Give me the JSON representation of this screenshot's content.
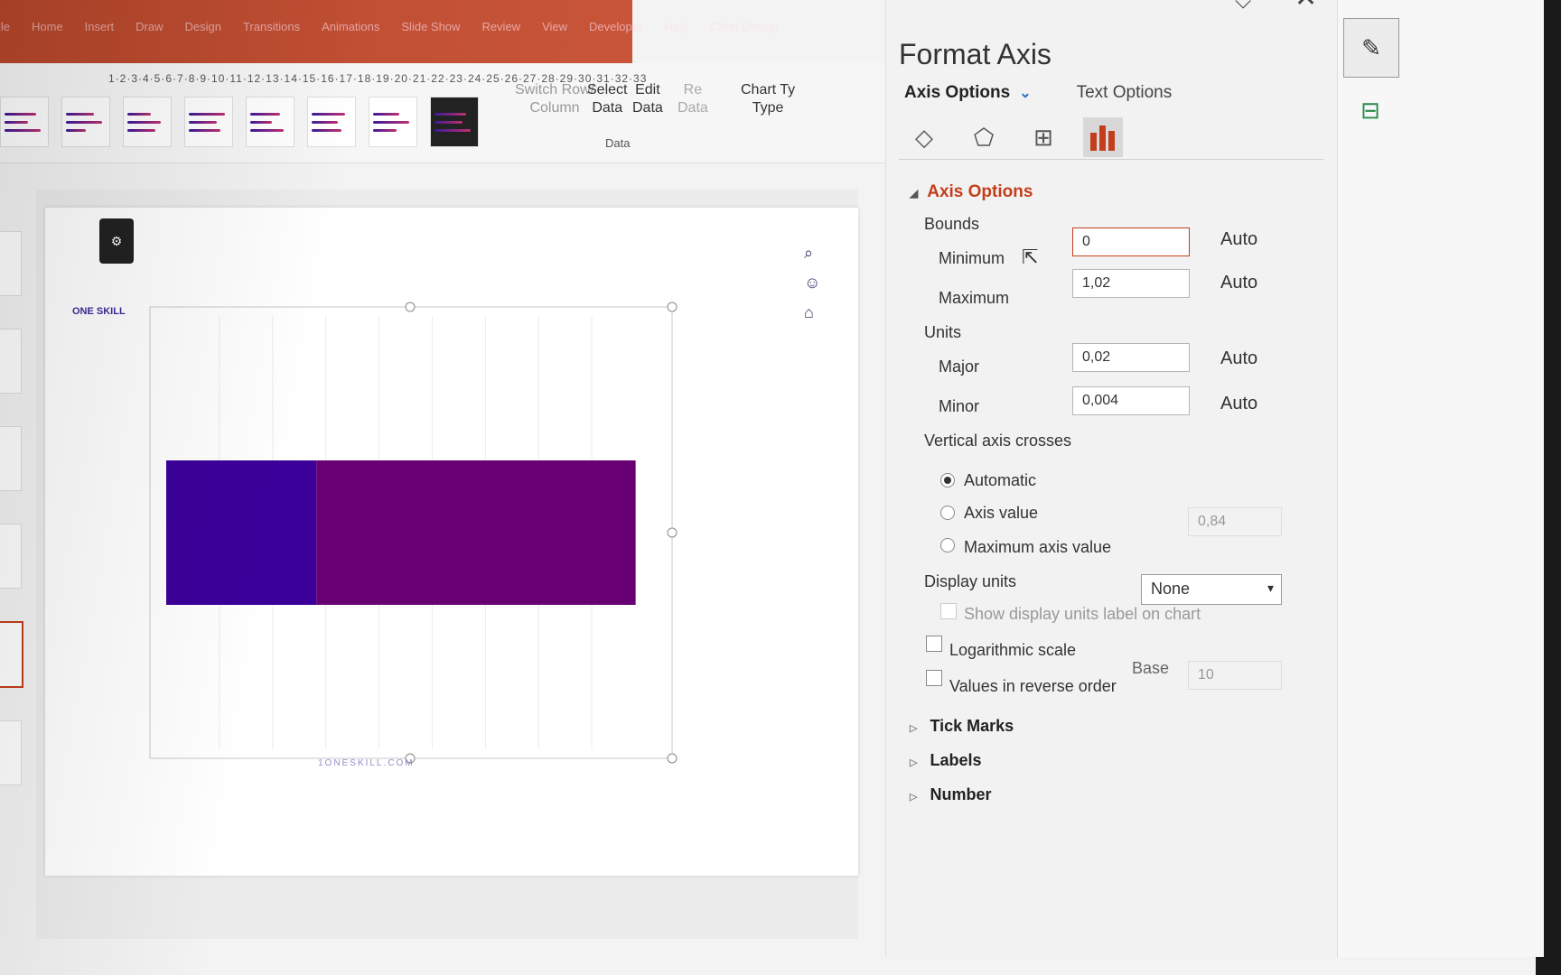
{
  "ribbon": {
    "tabs": [
      "File",
      "Home",
      "Insert",
      "Draw",
      "Design",
      "Transitions",
      "Animations",
      "Slide Show",
      "Review",
      "View",
      "Developer",
      "Help",
      "Chart Design"
    ],
    "group_switch": [
      "Switch Row/",
      "Column"
    ],
    "group_select": [
      "Select",
      "Data"
    ],
    "group_edit": [
      "Edit",
      "Data"
    ],
    "group_refresh": [
      "Re",
      "Data"
    ],
    "group_data_caption": "Data",
    "group_type": [
      "Chart Ty",
      "Type"
    ]
  },
  "ruler": "1·2·3·4·5·6·7·8·9·10·11·12·13·14·15·16·17·18·19·20·21·22·23·24·25·26·27·28·29·30·31·32·33",
  "slide": {
    "logo": "ONE SKILL",
    "website": "1ONESKILL.COM"
  },
  "chart_data": {
    "type": "bar",
    "orientation": "horizontal",
    "stacked": true,
    "categories": [
      ""
    ],
    "series": [
      {
        "values": [
          0.32
        ],
        "color": "#3b009a"
      },
      {
        "values": [
          0.68
        ],
        "color": "#680074"
      }
    ],
    "xlim": [
      0,
      1.02
    ]
  },
  "format_axis": {
    "title": "Format Axis",
    "tab_axis_options": "Axis Options",
    "tab_text_options": "Text Options",
    "section_title": "Axis Options",
    "bounds_label": "Bounds",
    "minimum_label": "Minimum",
    "minimum_value": "0",
    "maximum_label": "Maximum",
    "maximum_value": "1,02",
    "units_label": "Units",
    "major_label": "Major",
    "major_value": "0,02",
    "minor_label": "Minor",
    "minor_value": "0,004",
    "auto_label": "Auto",
    "vertical_axis_crosses_label": "Vertical axis crosses",
    "radio_automatic": "Automatic",
    "radio_axis_value": "Axis value",
    "axis_value": "0,84",
    "radio_max_axis_value": "Maximum axis value",
    "display_units_label": "Display units",
    "display_units_value": "None",
    "show_display_units_label": "Show display units label on chart",
    "log_scale_label": "Logarithmic scale",
    "base_label": "Base",
    "base_value": "10",
    "reverse_order_label": "Values in reverse order",
    "tick_marks": "Tick Marks",
    "labels": "Labels",
    "number": "Number"
  },
  "colors": {
    "accent": "#c43e1c",
    "bar_series_1": "#3b009a",
    "bar_series_2": "#680074"
  },
  "icons": [
    "fill-line-icon",
    "effects-icon",
    "size-properties-icon",
    "axis-options-icon",
    "search-icon",
    "person-icon",
    "home-icon",
    "format-pane-icon",
    "chart-elements-icon"
  ]
}
